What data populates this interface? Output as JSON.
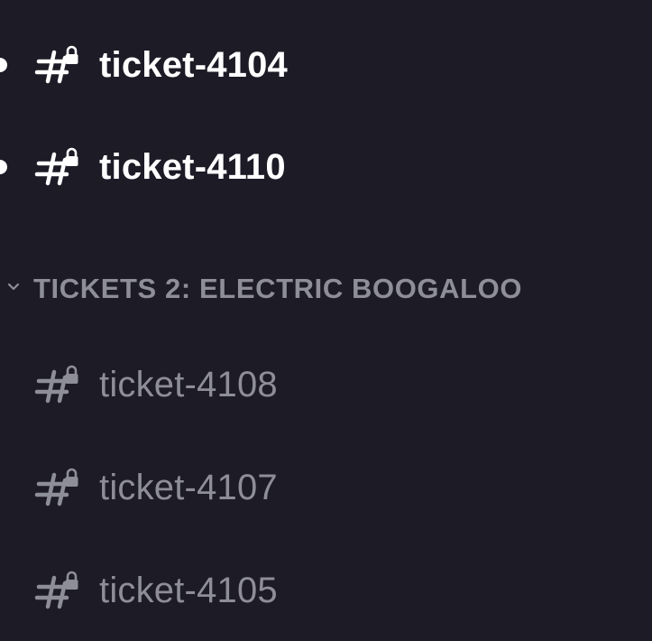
{
  "sidebar": {
    "unread_channels": [
      {
        "name": "ticket-4104",
        "icon": "locked-text-channel-icon"
      },
      {
        "name": "ticket-4110",
        "icon": "locked-text-channel-icon"
      }
    ],
    "category": {
      "name": "TICKETS 2: ELECTRIC BOOGALOO",
      "icon": "chevron-down-icon",
      "channels": [
        {
          "name": "ticket-4108",
          "icon": "locked-text-channel-icon"
        },
        {
          "name": "ticket-4107",
          "icon": "locked-text-channel-icon"
        },
        {
          "name": "ticket-4105",
          "icon": "locked-text-channel-icon"
        }
      ]
    }
  },
  "colors": {
    "background": "#1c1b26",
    "unread_text": "#ffffff",
    "read_text": "#8e8e98",
    "category_text": "#8e8e98"
  }
}
